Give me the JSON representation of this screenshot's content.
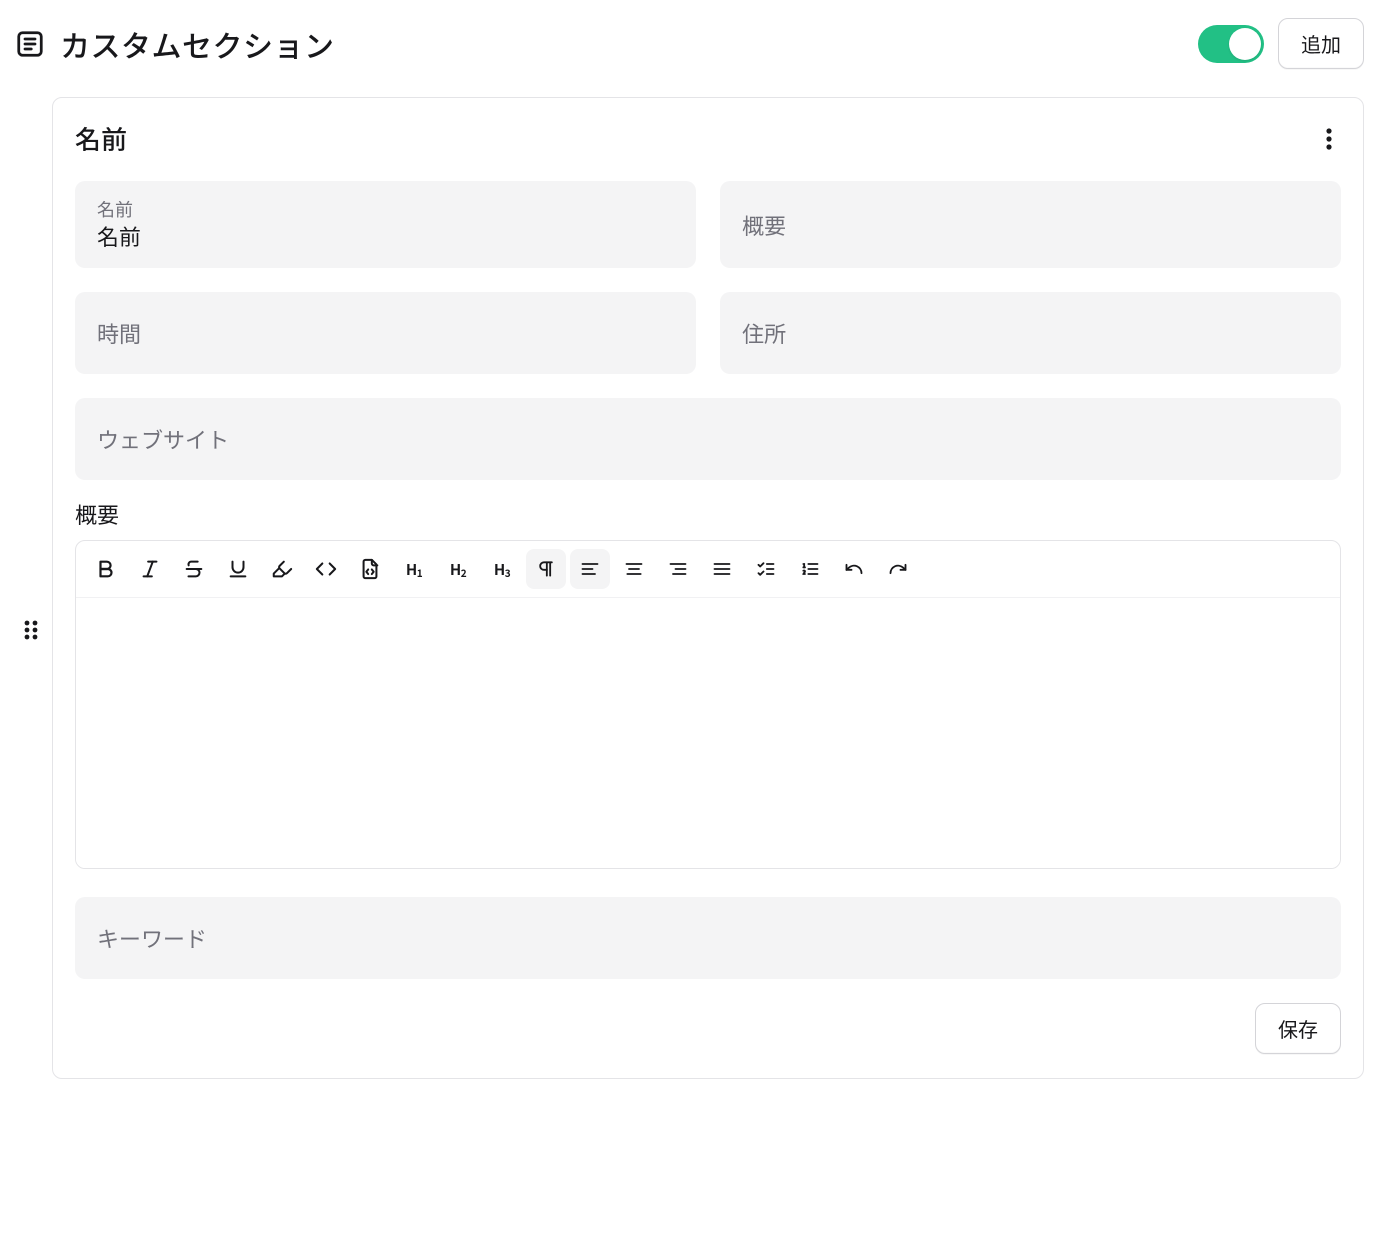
{
  "header": {
    "title": "カスタムセクション",
    "toggle_on": true,
    "add_button_label": "追加"
  },
  "card": {
    "title": "名前",
    "fields": {
      "name": {
        "label": "名前",
        "value": "名前"
      },
      "overview": {
        "placeholder": "概要"
      },
      "time": {
        "placeholder": "時間"
      },
      "address": {
        "placeholder": "住所"
      },
      "website": {
        "placeholder": "ウェブサイト"
      },
      "keywords": {
        "placeholder": "キーワード"
      }
    },
    "summary_section_label": "概要",
    "save_button_label": "保存"
  },
  "toolbar": {
    "h1": "H1",
    "h2": "H2",
    "h3": "H3"
  }
}
